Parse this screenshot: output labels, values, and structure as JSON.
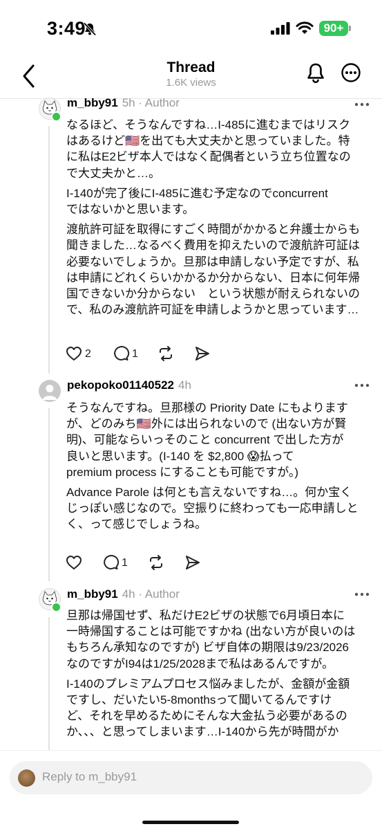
{
  "status_bar": {
    "time": "3:49",
    "battery": "90+"
  },
  "header": {
    "title": "Thread",
    "views": "1.6K views"
  },
  "posts": [
    {
      "username": "m_bby91",
      "meta": "5h · Author",
      "paragraphs": [
        [
          "なるほど、そうなんですね…I-485に進むまではリスク",
          "はあるけど🇺🇸を出ても大丈夫かと思っていました。特",
          "に私はE2ビザ本人ではなく配偶者という立ち位置なの",
          "で大丈夫かと…。"
        ],
        [
          "I-140が完了後にI-485に進む予定なのでconcurrent",
          "ではないかと思います。"
        ],
        [
          "渡航許可証を取得にすごく時間がかかると弁護士からも",
          "聞きました…なるべく費用を抑えたいので渡航許可証は",
          "必要ないでしょうか。旦那は申請しない予定ですが、私",
          "は申請にどれくらいかかるか分からない、日本に何年帰",
          "国できないか分からない　という状態が耐えられないの",
          "で、私のみ渡航許可証を申請しようかと思っています…"
        ]
      ],
      "likes": "2",
      "comments": "1"
    },
    {
      "username": "pekopoko01140522",
      "meta": "4h",
      "paragraphs": [
        [
          "そうなんですね。旦那様の Priority Date にもよります",
          "が、どのみち🇺🇸外には出られないので (出ない方が賢",
          "明)、可能ならいっそのこと concurrent で出した方が",
          "良いと思います。(I-140 を $2,800 😱払って",
          "premium process にすることも可能ですが。)"
        ],
        [
          "Advance Parole は何とも言えないですね…。何か宝く",
          "じっぽい感じなので。空振りに終わっても一応申請しと",
          "く、って感じでしょうね。"
        ]
      ],
      "likes": "",
      "comments": "1"
    },
    {
      "username": "m_bby91",
      "meta": "4h · Author",
      "paragraphs": [
        [
          "旦那は帰国せず、私だけE2ビザの状態で6月頃日本に",
          "一時帰国することは可能ですかね (出ない方が良いのは",
          "もちろん承知なのですが) ビザ自体の期限は9/23/2026",
          "なのですがI94は1/25/2028まで私はあるんですが。"
        ],
        [
          "I-140のプレミアムプロセス悩みましたが、金額が金額",
          "ですし、だいたい5-8monthsって聞いてるんですけ",
          "ど、それを早めるためにそんな大金払う必要があるの",
          "か、、、と思ってしまいます…I-140から先が時間がか"
        ]
      ]
    }
  ],
  "reply_bar": {
    "placeholder": "Reply to m_bby91"
  },
  "icons": {
    "back": "chevron-left-icon",
    "notifications": "bell-icon",
    "more": "ellipsis-circle-icon",
    "like": "heart-icon",
    "comment": "comment-bubble-icon",
    "repost": "repost-icon",
    "share": "send-icon"
  },
  "colors": {
    "battery": "#34c759",
    "online_dot": "#3ac24a",
    "meta_text": "#999999"
  }
}
